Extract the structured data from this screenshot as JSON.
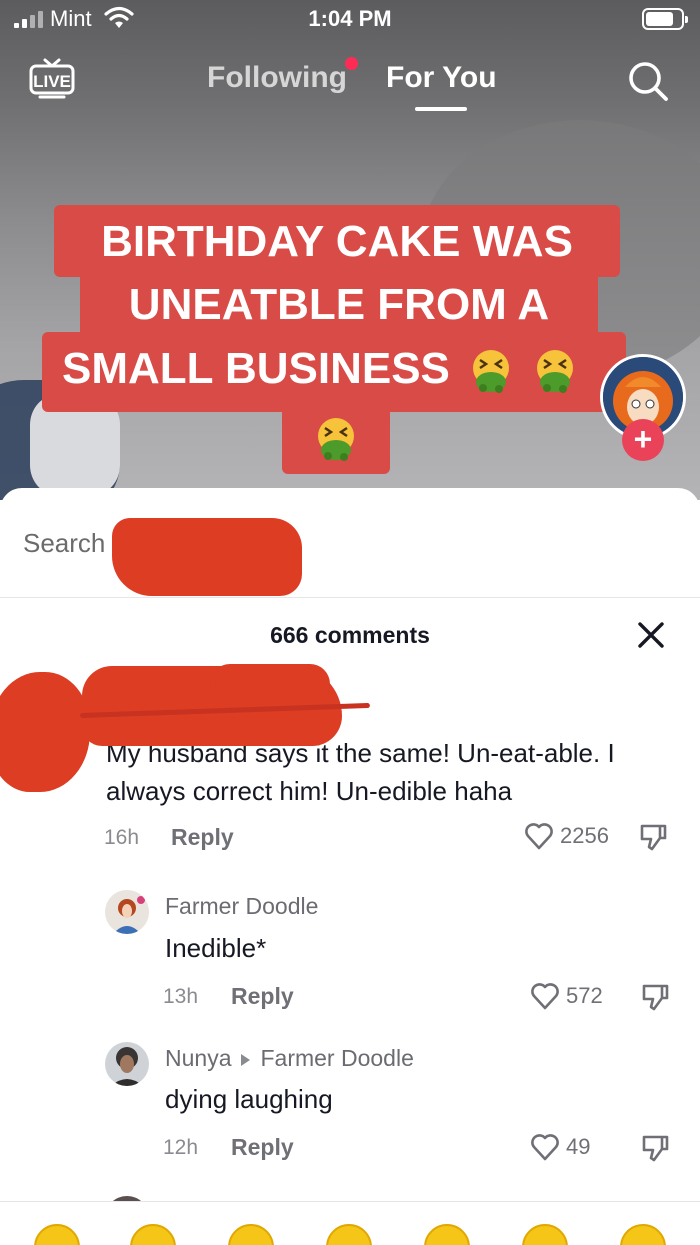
{
  "status_bar": {
    "carrier": "Mint",
    "time": "1:04 PM"
  },
  "top_nav": {
    "live_label": "LIVE",
    "tab_following": "Following",
    "tab_for_you": "For You"
  },
  "video": {
    "caption_line1": "BIRTHDAY CAKE WAS",
    "caption_line2": "UNEATBLE FROM A",
    "caption_line3": "SMALL BUSINESS",
    "caption_emoji": "nauseated-vomiting-face",
    "follow_plus": "+"
  },
  "comments_panel": {
    "search_label": "Search",
    "count_label": "666 comments",
    "comments": [
      {
        "text": "My husband says it the same! Un-eat-able. I always correct him! Un-edible haha",
        "time": "16h",
        "reply_label": "Reply",
        "likes": "2256"
      },
      {
        "author": "Farmer Doodle",
        "text": "Inedible*",
        "time": "13h",
        "reply_label": "Reply",
        "likes": "572"
      },
      {
        "author": "Nunya",
        "reply_to": "Farmer Doodle",
        "text": "dying laughing",
        "time": "12h",
        "reply_label": "Reply",
        "likes": "49"
      }
    ]
  },
  "colors": {
    "caption_bg": "#d94b47",
    "tiktok_red": "#fe2c55",
    "redaction": "#dc3d23"
  }
}
